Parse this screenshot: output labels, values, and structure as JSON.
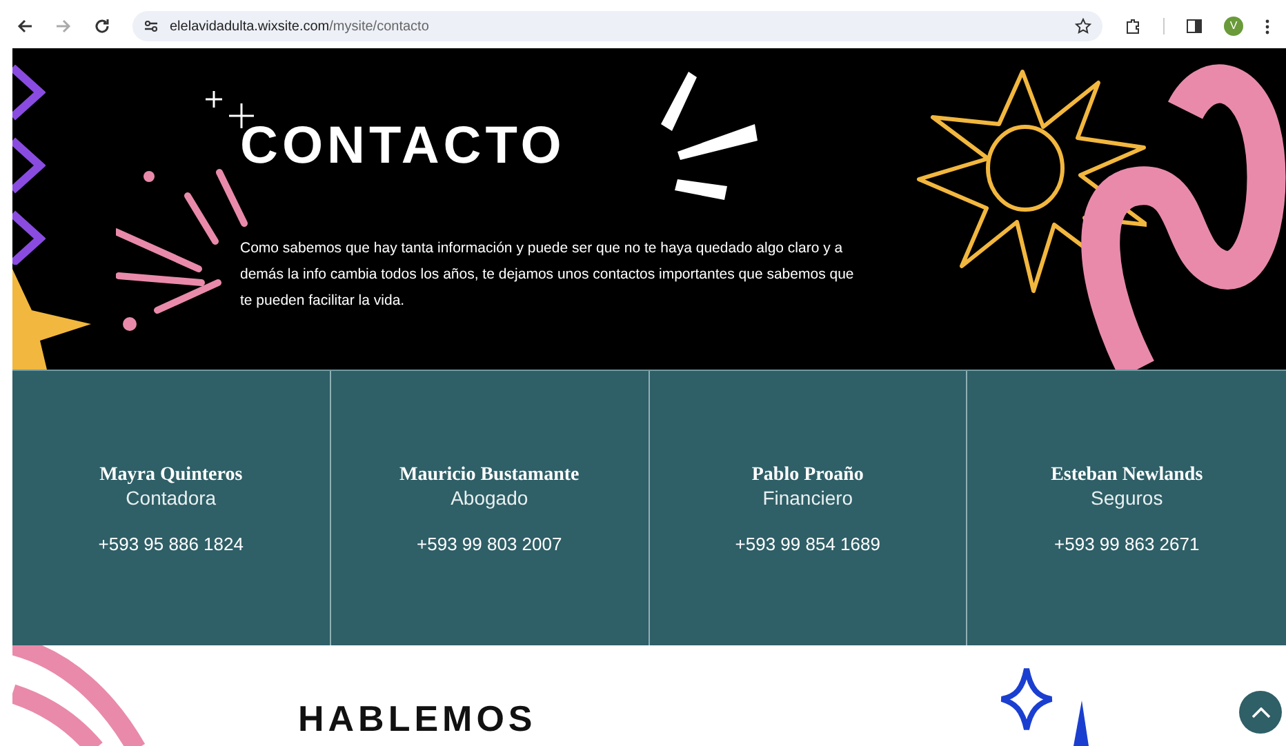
{
  "browser": {
    "url_host": "elelavidadulta.wixsite.com",
    "url_path": "/mysite/contacto",
    "profile_initial": "V"
  },
  "hero": {
    "title": "CONTACTO",
    "description": "Como sabemos que hay tanta información y puede ser que no te haya quedado algo claro y a demás la info cambia todos los años, te dejamos unos contactos importantes que sabemos que te pueden facilitar la vida."
  },
  "contacts": [
    {
      "name": "Mayra Quinteros",
      "role": "Contadora",
      "phone": "+593 95 886 1824"
    },
    {
      "name": "Mauricio Bustamante",
      "role": "Abogado",
      "phone": "+593 99 803 2007"
    },
    {
      "name": "Pablo Proaño",
      "role": "Financiero",
      "phone": "+593 99 854 1689"
    },
    {
      "name": "Esteban Newlands",
      "role": "Seguros",
      "phone": "+593 99 863 2671"
    }
  ],
  "section": {
    "title": "HABLEMOS"
  }
}
